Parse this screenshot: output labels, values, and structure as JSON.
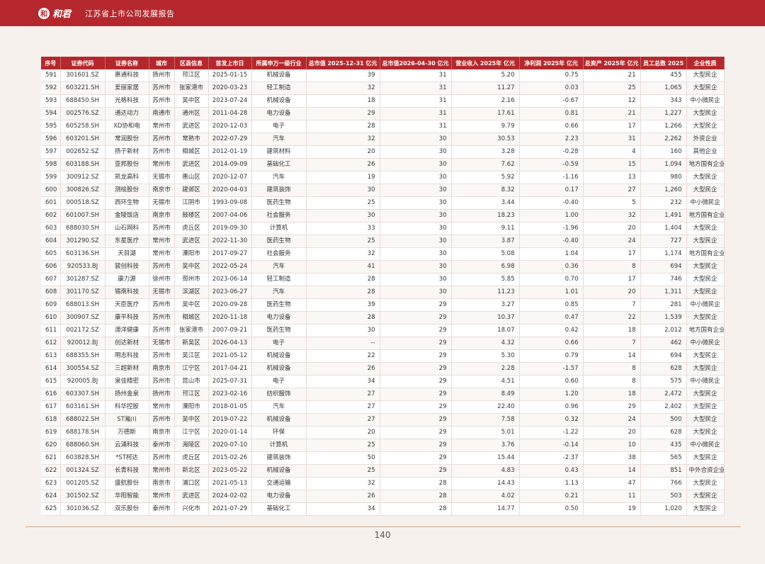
{
  "header": {
    "logo_mark": "和",
    "logo_text": "和君",
    "report_title": "江苏省上市公司发展报告"
  },
  "table": {
    "columns": [
      "序号",
      "证券代码",
      "证券名称",
      "城市",
      "区县信息",
      "首发上市日",
      "所属申万一级行业",
      "总市值 2025-12-31 亿元",
      "总市值2026-04-30 亿元",
      "营业收入 2025年 亿元",
      "净利润 2025年 亿元",
      "总资产 2025年 亿元",
      "员工总数 2025",
      "企业性质"
    ],
    "rows": [
      [
        "591",
        "301601.SZ",
        "惠通科技",
        "扬州市",
        "邗江区",
        "2025-01-15",
        "机械设备",
        "39",
        "31",
        "5.20",
        "0.75",
        "21",
        "455",
        "大型民企"
      ],
      [
        "592",
        "603221.SH",
        "爱丽家居",
        "苏州市",
        "张家港市",
        "2020-03-23",
        "轻工制造",
        "32",
        "31",
        "11.27",
        "0.03",
        "25",
        "1,065",
        "大型民企"
      ],
      [
        "593",
        "688450.SH",
        "光格科技",
        "苏州市",
        "吴中区",
        "2023-07-24",
        "机械设备",
        "18",
        "31",
        "2.16",
        "-0.67",
        "12",
        "343",
        "中小微民企"
      ],
      [
        "594",
        "002576.SZ",
        "通达动力",
        "南通市",
        "通州区",
        "2011-04-28",
        "电力设备",
        "29",
        "31",
        "17.61",
        "0.81",
        "21",
        "1,227",
        "大型民企"
      ],
      [
        "595",
        "605258.SH",
        "XD协和电",
        "常州市",
        "武进区",
        "2020-12-03",
        "电子",
        "28",
        "31",
        "9.79",
        "0.66",
        "17",
        "1,266",
        "大型民企"
      ],
      [
        "596",
        "603201.SH",
        "常润股份",
        "苏州市",
        "常熟市",
        "2022-07-29",
        "汽车",
        "32",
        "30",
        "30.53",
        "2.23",
        "31",
        "2,262",
        "外资企业"
      ],
      [
        "597",
        "002652.SZ",
        "扬子新材",
        "苏州市",
        "相城区",
        "2012-01-19",
        "建筑材料",
        "20",
        "30",
        "3.28",
        "-0.28",
        "4",
        "160",
        "其他企业"
      ],
      [
        "598",
        "603188.SH",
        "亚邦股份",
        "常州市",
        "武进区",
        "2014-09-09",
        "基础化工",
        "26",
        "30",
        "7.62",
        "-0.59",
        "15",
        "1,094",
        "地方国有企业"
      ],
      [
        "599",
        "300912.SZ",
        "凯龙高科",
        "无锡市",
        "惠山区",
        "2020-12-07",
        "汽车",
        "19",
        "30",
        "5.92",
        "-1.16",
        "13",
        "980",
        "大型民企"
      ],
      [
        "600",
        "300826.SZ",
        "测绘股份",
        "南京市",
        "建邺区",
        "2020-04-03",
        "建筑装饰",
        "30",
        "30",
        "8.32",
        "0.17",
        "27",
        "1,260",
        "大型民企"
      ],
      [
        "601",
        "000518.SZ",
        "西环生物",
        "无锡市",
        "江阴市",
        "1993-09-08",
        "医药生物",
        "25",
        "30",
        "3.44",
        "-0.40",
        "5",
        "232",
        "中小微民企"
      ],
      [
        "602",
        "601007.SH",
        "金陵饭店",
        "南京市",
        "鼓楼区",
        "2007-04-06",
        "社会服务",
        "30",
        "30",
        "18.23",
        "1.00",
        "32",
        "1,491",
        "地方国有企业"
      ],
      [
        "603",
        "688030.SH",
        "山石网科",
        "苏州市",
        "虎丘区",
        "2019-09-30",
        "计算机",
        "33",
        "30",
        "9.11",
        "-1.96",
        "20",
        "1,404",
        "大型民企"
      ],
      [
        "604",
        "301290.SZ",
        "东星医疗",
        "常州市",
        "武进区",
        "2022-11-30",
        "医药生物",
        "25",
        "30",
        "3.87",
        "-0.40",
        "24",
        "727",
        "大型民企"
      ],
      [
        "605",
        "603136.SH",
        "天目湖",
        "常州市",
        "溧阳市",
        "2017-09-27",
        "社会服务",
        "32",
        "30",
        "5.08",
        "1.04",
        "17",
        "1,174",
        "地方国有企业"
      ],
      [
        "606",
        "920533.BJ",
        "骏创科技",
        "苏州市",
        "吴中区",
        "2022-05-24",
        "汽车",
        "41",
        "30",
        "6.98",
        "0.36",
        "8",
        "694",
        "大型民企"
      ],
      [
        "607",
        "301287.SZ",
        "康力源",
        "徐州市",
        "邳州市",
        "2023-06-14",
        "轻工制造",
        "28",
        "30",
        "5.85",
        "0.70",
        "17",
        "746",
        "大型民企"
      ],
      [
        "608",
        "301170.SZ",
        "锡南科技",
        "无锡市",
        "滨湖区",
        "2023-06-27",
        "汽车",
        "28",
        "30",
        "11.23",
        "1.01",
        "20",
        "1,311",
        "大型民企"
      ],
      [
        "609",
        "688013.SH",
        "天臣医疗",
        "苏州市",
        "吴中区",
        "2020-09-28",
        "医药生物",
        "39",
        "29",
        "3.27",
        "0.85",
        "7",
        "281",
        "中小微民企"
      ],
      [
        "610",
        "300907.SZ",
        "康平科技",
        "苏州市",
        "相城区",
        "2020-11-18",
        "电力设备",
        "28",
        "29",
        "10.37",
        "0.47",
        "22",
        "1,539",
        "大型民企"
      ],
      [
        "611",
        "002172.SZ",
        "澳洋健康",
        "苏州市",
        "张家港市",
        "2007-09-21",
        "医药生物",
        "30",
        "29",
        "18.07",
        "0.42",
        "18",
        "2,012",
        "地方国有企业"
      ],
      [
        "612",
        "920012.BJ",
        "创达新材",
        "无锡市",
        "新吴区",
        "2026-04-13",
        "电子",
        "--",
        "29",
        "4.32",
        "0.66",
        "7",
        "462",
        "中小微民企"
      ],
      [
        "613",
        "688355.SH",
        "明志科技",
        "苏州市",
        "吴江区",
        "2021-05-12",
        "机械设备",
        "22",
        "29",
        "5.30",
        "0.79",
        "14",
        "694",
        "大型民企"
      ],
      [
        "614",
        "300554.SZ",
        "三超新材",
        "南京市",
        "江宁区",
        "2017-04-21",
        "机械设备",
        "26",
        "29",
        "2.28",
        "-1.57",
        "8",
        "628",
        "大型民企"
      ],
      [
        "615",
        "920005.BJ",
        "泉佳精密",
        "苏州市",
        "昆山市",
        "2025-07-31",
        "电子",
        "34",
        "29",
        "4.51",
        "0.60",
        "8",
        "575",
        "中小微民企"
      ],
      [
        "616",
        "603307.SH",
        "扬州金泉",
        "扬州市",
        "邗江区",
        "2023-02-16",
        "纺织服饰",
        "27",
        "29",
        "8.49",
        "1.20",
        "18",
        "2,472",
        "大型民企"
      ],
      [
        "617",
        "603161.SH",
        "科华控股",
        "常州市",
        "溧阳市",
        "2018-01-05",
        "汽车",
        "27",
        "29",
        "22.40",
        "0.96",
        "29",
        "2,402",
        "大型民企"
      ],
      [
        "618",
        "688022.SH",
        "ST瀚川",
        "苏州市",
        "吴中区",
        "2019-07-22",
        "机械设备",
        "27",
        "29",
        "7.58",
        "0.32",
        "24",
        "500",
        "大型民企"
      ],
      [
        "619",
        "688178.SH",
        "万德斯",
        "南京市",
        "江宁区",
        "2020-01-14",
        "环保",
        "20",
        "29",
        "5.01",
        "-1.22",
        "20",
        "628",
        "大型民企"
      ],
      [
        "620",
        "688060.SH",
        "云涌科技",
        "泰州市",
        "海陵区",
        "2020-07-10",
        "计算机",
        "25",
        "29",
        "3.76",
        "-0.14",
        "10",
        "435",
        "中小微民企"
      ],
      [
        "621",
        "603828.SH",
        "*ST柯达",
        "苏州市",
        "虎丘区",
        "2015-02-26",
        "建筑装饰",
        "50",
        "29",
        "15.44",
        "-2.37",
        "38",
        "565",
        "大型民企"
      ],
      [
        "622",
        "001324.SZ",
        "长青科技",
        "常州市",
        "新北区",
        "2023-05-22",
        "机械设备",
        "25",
        "29",
        "4.83",
        "0.43",
        "14",
        "851",
        "中外合资企业"
      ],
      [
        "623",
        "001205.SZ",
        "盛航股份",
        "南京市",
        "浦口区",
        "2021-05-13",
        "交通运输",
        "32",
        "28",
        "14.43",
        "1.13",
        "47",
        "766",
        "大型民企"
      ],
      [
        "624",
        "301502.SZ",
        "华阳智能",
        "常州市",
        "武进区",
        "2024-02-02",
        "电力设备",
        "26",
        "28",
        "4.02",
        "0.21",
        "11",
        "503",
        "大型民企"
      ],
      [
        "625",
        "301036.SZ",
        "双乐股份",
        "泰州市",
        "兴化市",
        "2021-07-29",
        "基础化工",
        "34",
        "28",
        "14.77",
        "0.50",
        "19",
        "1,020",
        "大型民企"
      ]
    ]
  },
  "footer": {
    "page_number": "140"
  }
}
